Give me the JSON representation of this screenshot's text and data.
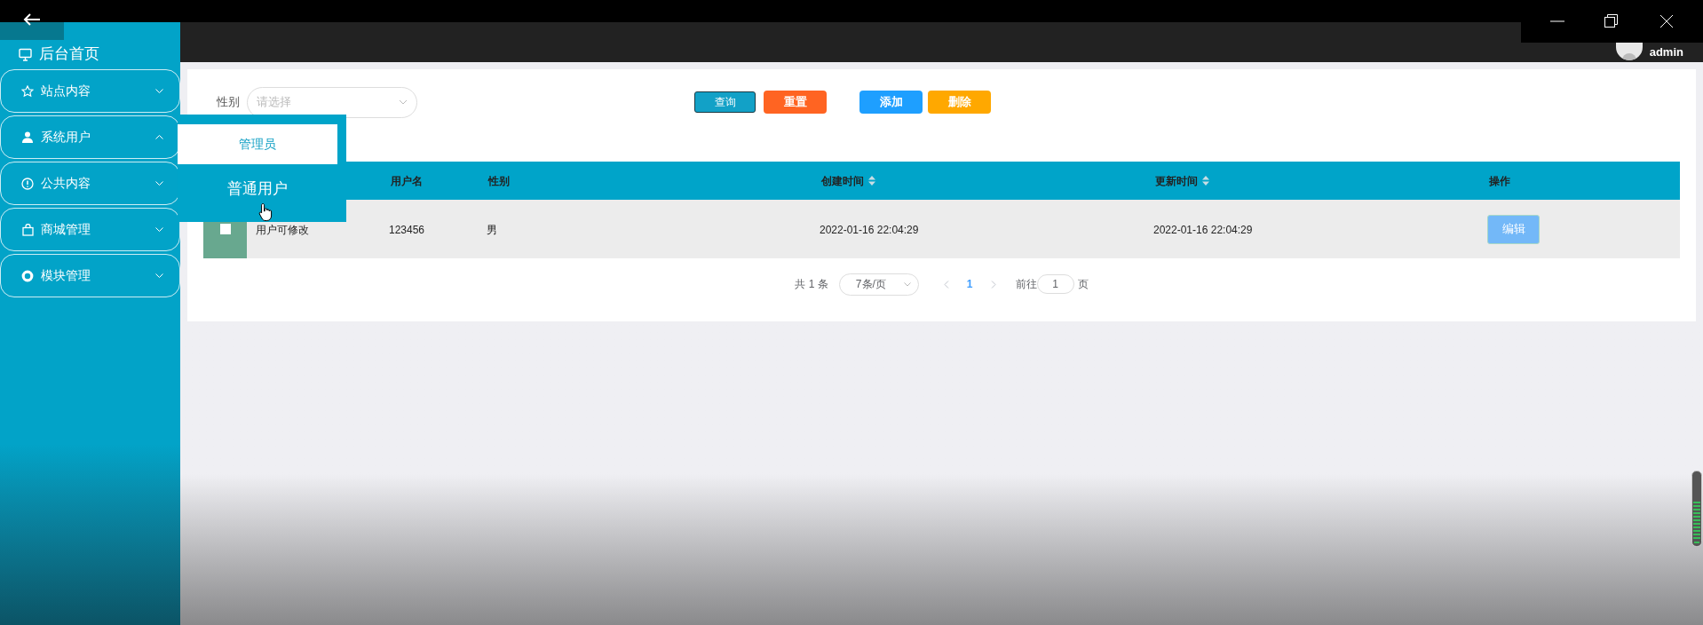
{
  "sidebar": {
    "home": "后台首页",
    "menus": [
      {
        "label": "站点内容",
        "expanded": false
      },
      {
        "label": "系统用户",
        "expanded": true
      },
      {
        "label": "公共内容",
        "expanded": false
      },
      {
        "label": "商城管理",
        "expanded": false
      },
      {
        "label": "模块管理",
        "expanded": false
      }
    ]
  },
  "submenu": {
    "items": [
      {
        "label": "管理员",
        "selected": true
      },
      {
        "label": "普通用户",
        "selected": false
      }
    ]
  },
  "header": {
    "user": "admin"
  },
  "filter": {
    "label": "性别",
    "placeholder": "请选择"
  },
  "buttons": [
    {
      "label": "查询",
      "kind": "search"
    },
    {
      "label": "重置",
      "kind": "reset"
    },
    {
      "label": "添加",
      "kind": "add"
    },
    {
      "label": "删除",
      "kind": "delete"
    }
  ],
  "table": {
    "columns": [
      {
        "label": "用户名",
        "sortable": false
      },
      {
        "label": "性别",
        "sortable": false
      },
      {
        "label": "创建时间",
        "sortable": true
      },
      {
        "label": "更新时间",
        "sortable": true
      },
      {
        "label": "操作",
        "sortable": false
      }
    ],
    "rows": [
      {
        "checked": false,
        "column_2": "用户可修改",
        "cells": [
          "123456",
          "男",
          "2022-01-16 22:04:29",
          "2022-01-16 22:04:29"
        ],
        "action": "编辑"
      }
    ]
  },
  "pagination": {
    "total": "共 1 条",
    "page_size": "7条/页",
    "pages": [
      {
        "label": "1",
        "selected": true
      }
    ],
    "goto_label": "前往",
    "goto_value": "1",
    "goto_suffix": "页"
  }
}
